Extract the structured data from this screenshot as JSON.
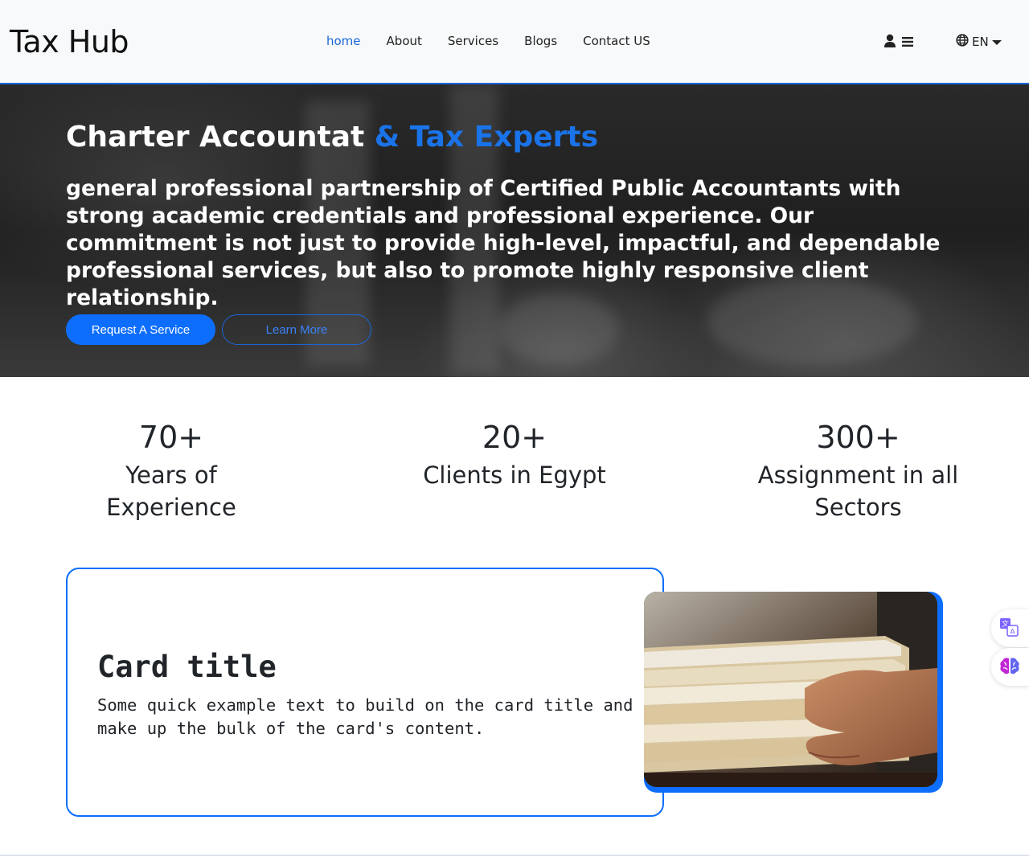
{
  "navbar": {
    "brand": "Tax Hub",
    "links": [
      "home",
      "About",
      "Services",
      "Blogs",
      "Contact US"
    ],
    "language": "EN"
  },
  "hero": {
    "title_main": "Charter Accountat",
    "title_accent": " & Tax Experts",
    "text": "general professional partnership of Certified Public Accountants with strong academic credentials and professional experience. Our commitment is not just to provide high-level, impactful, and dependable professional services, but also to promote highly responsive client relationship.",
    "primary_button": "Request A Service",
    "secondary_button": "Learn More"
  },
  "stats": [
    {
      "number": "70+",
      "label": "Years of Experience"
    },
    {
      "number": "20+",
      "label": "Clients in Egypt"
    },
    {
      "number": "300+",
      "label": "Assignment in all Sectors"
    }
  ],
  "card": {
    "title": "Card title",
    "text": "Some quick example text to build on the card title and make up the bulk of the card's content."
  },
  "icons": {
    "user": "user-icon",
    "menu": "menu-icon",
    "globe": "globe-icon",
    "caret": "caret-down-icon",
    "translate": "translate-icon",
    "brain": "brain-icon"
  },
  "colors": {
    "accent": "#0d6efd",
    "navbar_bg": "#f8f9fa",
    "hero_bg": "#222222"
  }
}
